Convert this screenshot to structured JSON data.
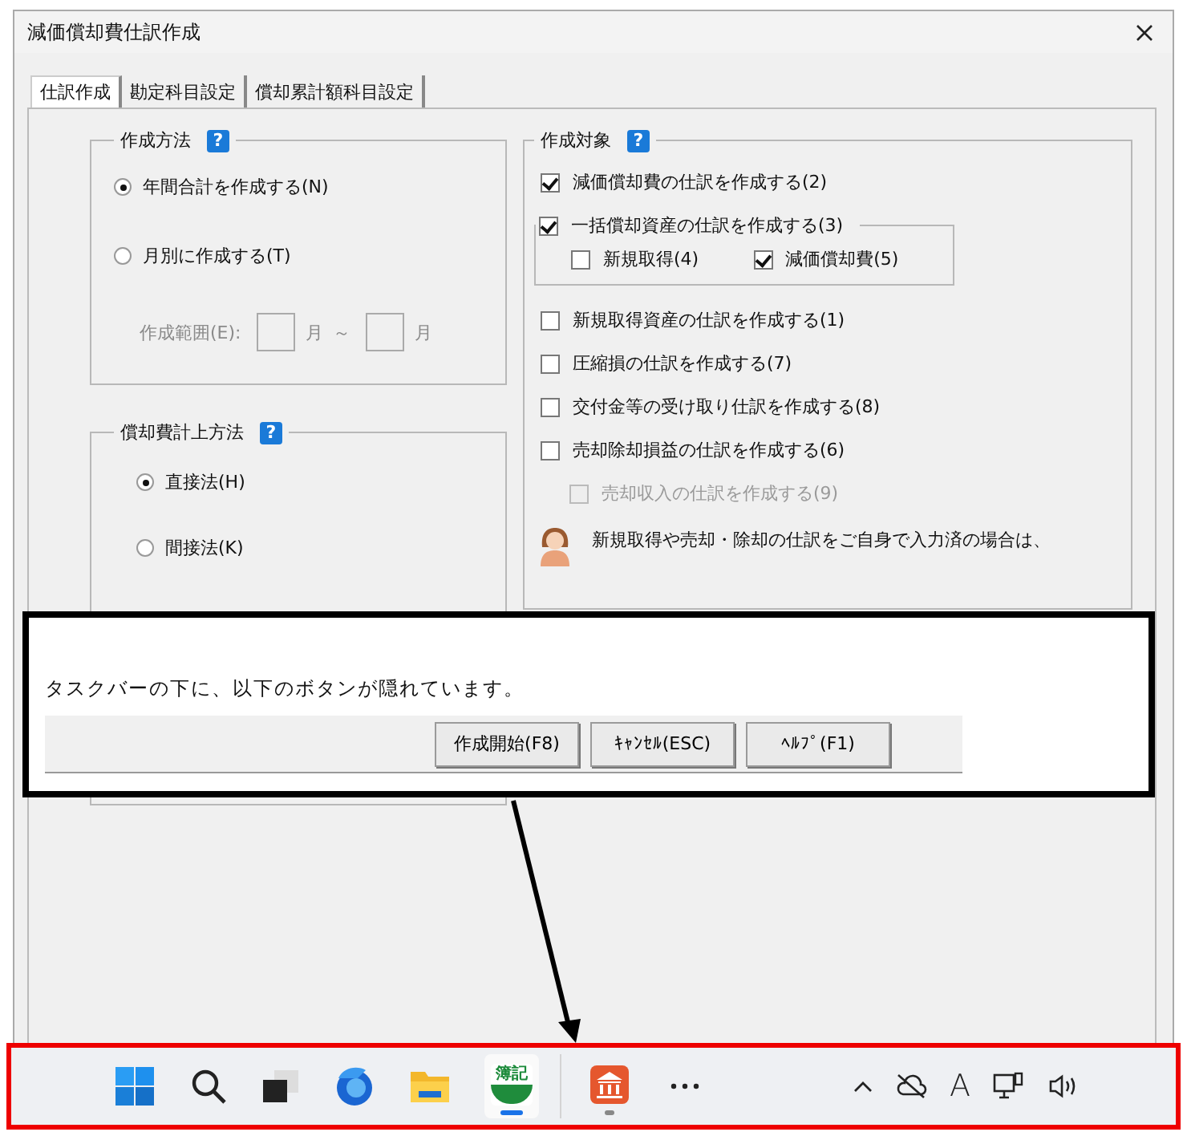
{
  "window": {
    "title": "減価償却費仕訳作成"
  },
  "tabs": [
    {
      "label": "仕訳作成",
      "selected": true
    },
    {
      "label": "勘定科目設定",
      "selected": false
    },
    {
      "label": "償却累計額科目設定",
      "selected": false
    }
  ],
  "creation_method": {
    "title": "作成方法",
    "help": "?",
    "options": [
      {
        "label": "年間合計を作成する(N)",
        "selected": true
      },
      {
        "label": "月別に作成する(T)",
        "selected": false
      }
    ],
    "range": {
      "label": "作成範囲(E):",
      "from_unit": "月",
      "separator": "～",
      "to_unit": "月",
      "disabled": true
    }
  },
  "depreciation_method": {
    "title": "償却費計上方法",
    "help": "?",
    "options": [
      {
        "label": "直接法(H)",
        "selected": true
      },
      {
        "label": "間接法(K)",
        "selected": false
      }
    ]
  },
  "targets": {
    "title": "作成対象",
    "help": "?",
    "items": [
      {
        "kind": "check",
        "label": "減価償却費の仕訳を作成する(2)",
        "checked": true,
        "disabled": false
      },
      {
        "kind": "group",
        "label": "一括償却資産の仕訳を作成する(3)",
        "checked": true,
        "children": [
          {
            "label": "新規取得(4)",
            "checked": false
          },
          {
            "label": "減価償却費(5)",
            "checked": true
          }
        ]
      },
      {
        "kind": "check",
        "label": "新規取得資産の仕訳を作成する(1)",
        "checked": false,
        "disabled": false
      },
      {
        "kind": "check",
        "label": "圧縮損の仕訳を作成する(7)",
        "checked": false,
        "disabled": false
      },
      {
        "kind": "check",
        "label": "交付金等の受け取り仕訳を作成する(8)",
        "checked": false,
        "disabled": false
      },
      {
        "kind": "check",
        "label": "売却除却損益の仕訳を作成する(6)",
        "checked": false,
        "disabled": false
      },
      {
        "kind": "sub",
        "label": "売却収入の仕訳を作成する(9)",
        "checked": false,
        "disabled": true
      }
    ],
    "note": "新規取得や売却・除却の仕訳をご自身で入力済の場合は、"
  },
  "callout": {
    "text": "タスクバーの下に、以下のボタンが隠れています。",
    "buttons": [
      "作成開始(F8)",
      "ｷｬﾝｾﾙ(ESC)",
      "ﾍﾙﾌﾟ(F1)"
    ]
  },
  "taskbar": {
    "app_label": "簿記",
    "ime_mode": "A"
  }
}
